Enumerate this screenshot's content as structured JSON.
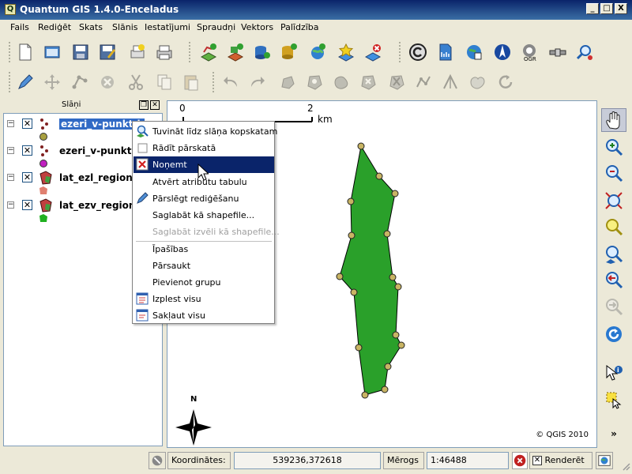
{
  "window": {
    "title": "Quantum GIS 1.4.0-Enceladus",
    "app_icon_letter": "Q",
    "minimize": "_",
    "maximize": "□",
    "close": "X"
  },
  "menu": [
    "Fails",
    "Rediģēt",
    "Skats",
    "Slānis",
    "Iestatījumi",
    "Spraudņi",
    "Vektors",
    "Palīdzība"
  ],
  "layers_panel": {
    "title": "Slāņi",
    "float_btn": "❐",
    "close_btn": "✕",
    "layers": [
      {
        "name": "ezeri_v-punkt-k",
        "visible_mark": "✕",
        "expander": "−",
        "selected": true,
        "symbol_color": "#a8a040"
      },
      {
        "name": "ezeri_v-punkti",
        "visible_mark": "✕",
        "expander": "−",
        "selected": false,
        "symbol_color": "#c020c0"
      },
      {
        "name": "lat_ezl_region",
        "visible_mark": "✕",
        "expander": "−",
        "selected": false,
        "symbol_color": "#e08070"
      },
      {
        "name": "lat_ezv_region",
        "visible_mark": "✕",
        "expander": "−",
        "selected": false,
        "symbol_color": "#20b020"
      }
    ]
  },
  "context_menu": {
    "items": [
      {
        "label": "Tuvināt līdz slāņa kopskatam",
        "icon": "zoom-layer-icon",
        "disabled": false,
        "highlight": false
      },
      {
        "label": "Rādīt pārskatā",
        "icon": "checkbox-icon",
        "disabled": false,
        "highlight": false
      },
      {
        "label": "Noņemt",
        "icon": "remove-icon",
        "disabled": false,
        "highlight": true
      },
      {
        "label": "Atvērt atribūtu tabulu",
        "icon": "",
        "disabled": false,
        "highlight": false
      },
      {
        "label": "Pārslēgt rediģēšanu",
        "icon": "pencil-icon",
        "disabled": false,
        "highlight": false
      },
      {
        "label": "Saglabāt kā shapefile...",
        "icon": "",
        "disabled": false,
        "highlight": false
      },
      {
        "label": "Saglabāt izvēli kā shapefile...",
        "icon": "",
        "disabled": true,
        "highlight": false
      },
      {
        "label": "Īpašības",
        "icon": "",
        "disabled": false,
        "highlight": false
      },
      {
        "label": "Pārsaukt",
        "icon": "",
        "disabled": false,
        "highlight": false
      },
      {
        "label": "Pievienot grupu",
        "icon": "",
        "disabled": false,
        "highlight": false
      },
      {
        "label": "Izplest visu",
        "icon": "expand-all-icon",
        "disabled": false,
        "highlight": false
      },
      {
        "label": "Sakļaut visu",
        "icon": "collapse-all-icon",
        "disabled": false,
        "highlight": false
      }
    ]
  },
  "map": {
    "scale_start": "0",
    "scale_end": "2",
    "scale_unit": "km",
    "north_label": "N",
    "copyright": "© QGIS 2010",
    "polygon_fill": "#2aa02a",
    "vertex_fill": "#c8b464"
  },
  "statusbar": {
    "coords_label": "Koordinātes:",
    "coords_value": "539236,372618",
    "scale_label": "Mērogs",
    "scale_value": "1:46488",
    "render_mark": "✕",
    "render_label": "Renderēt"
  },
  "right_toolbar": {
    "more_glyph": "»"
  }
}
